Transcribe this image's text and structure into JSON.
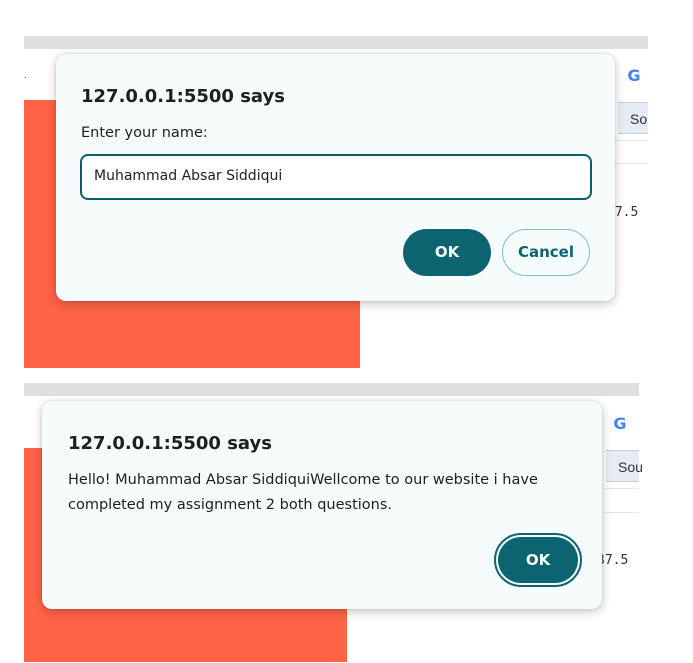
{
  "top_panel": {
    "background_tab_label": "So",
    "background_value": "37.5",
    "dialog": {
      "title": "127.0.0.1:5500 says",
      "message": "Enter your name:",
      "input_value": "Muhammad Absar Siddiqui",
      "ok_label": "OK",
      "cancel_label": "Cancel"
    }
  },
  "bottom_panel": {
    "background_tab_label": "Sou",
    "background_value": "37.5",
    "dialog": {
      "title": "127.0.0.1:5500 says",
      "message": "Hello! Muhammad Absar SiddiquiWellcome to our website i have completed my assignment 2 both questions.",
      "ok_label": "OK"
    }
  },
  "colors": {
    "accent": "#0c6470",
    "background_block": "#ff6347",
    "dialog_bg": "#f6fbfc"
  },
  "icons": [
    "google-g-icon"
  ]
}
